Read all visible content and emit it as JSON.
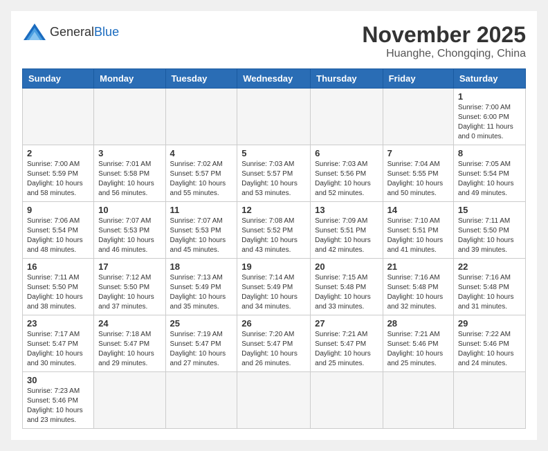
{
  "header": {
    "logo_general": "General",
    "logo_blue": "Blue",
    "title": "November 2025",
    "location": "Huanghe, Chongqing, China"
  },
  "weekdays": [
    "Sunday",
    "Monday",
    "Tuesday",
    "Wednesday",
    "Thursday",
    "Friday",
    "Saturday"
  ],
  "days": {
    "1": {
      "sunrise": "7:00 AM",
      "sunset": "6:00 PM",
      "hours": 11,
      "minutes": 0
    },
    "2": {
      "sunrise": "7:00 AM",
      "sunset": "5:59 PM",
      "hours": 10,
      "minutes": 58
    },
    "3": {
      "sunrise": "7:01 AM",
      "sunset": "5:58 PM",
      "hours": 10,
      "minutes": 56
    },
    "4": {
      "sunrise": "7:02 AM",
      "sunset": "5:57 PM",
      "hours": 10,
      "minutes": 55
    },
    "5": {
      "sunrise": "7:03 AM",
      "sunset": "5:57 PM",
      "hours": 10,
      "minutes": 53
    },
    "6": {
      "sunrise": "7:03 AM",
      "sunset": "5:56 PM",
      "hours": 10,
      "minutes": 52
    },
    "7": {
      "sunrise": "7:04 AM",
      "sunset": "5:55 PM",
      "hours": 10,
      "minutes": 50
    },
    "8": {
      "sunrise": "7:05 AM",
      "sunset": "5:54 PM",
      "hours": 10,
      "minutes": 49
    },
    "9": {
      "sunrise": "7:06 AM",
      "sunset": "5:54 PM",
      "hours": 10,
      "minutes": 48
    },
    "10": {
      "sunrise": "7:07 AM",
      "sunset": "5:53 PM",
      "hours": 10,
      "minutes": 46
    },
    "11": {
      "sunrise": "7:07 AM",
      "sunset": "5:53 PM",
      "hours": 10,
      "minutes": 45
    },
    "12": {
      "sunrise": "7:08 AM",
      "sunset": "5:52 PM",
      "hours": 10,
      "minutes": 43
    },
    "13": {
      "sunrise": "7:09 AM",
      "sunset": "5:51 PM",
      "hours": 10,
      "minutes": 42
    },
    "14": {
      "sunrise": "7:10 AM",
      "sunset": "5:51 PM",
      "hours": 10,
      "minutes": 41
    },
    "15": {
      "sunrise": "7:11 AM",
      "sunset": "5:50 PM",
      "hours": 10,
      "minutes": 39
    },
    "16": {
      "sunrise": "7:11 AM",
      "sunset": "5:50 PM",
      "hours": 10,
      "minutes": 38
    },
    "17": {
      "sunrise": "7:12 AM",
      "sunset": "5:50 PM",
      "hours": 10,
      "minutes": 37
    },
    "18": {
      "sunrise": "7:13 AM",
      "sunset": "5:49 PM",
      "hours": 10,
      "minutes": 35
    },
    "19": {
      "sunrise": "7:14 AM",
      "sunset": "5:49 PM",
      "hours": 10,
      "minutes": 34
    },
    "20": {
      "sunrise": "7:15 AM",
      "sunset": "5:48 PM",
      "hours": 10,
      "minutes": 33
    },
    "21": {
      "sunrise": "7:16 AM",
      "sunset": "5:48 PM",
      "hours": 10,
      "minutes": 32
    },
    "22": {
      "sunrise": "7:16 AM",
      "sunset": "5:48 PM",
      "hours": 10,
      "minutes": 31
    },
    "23": {
      "sunrise": "7:17 AM",
      "sunset": "5:47 PM",
      "hours": 10,
      "minutes": 30
    },
    "24": {
      "sunrise": "7:18 AM",
      "sunset": "5:47 PM",
      "hours": 10,
      "minutes": 29
    },
    "25": {
      "sunrise": "7:19 AM",
      "sunset": "5:47 PM",
      "hours": 10,
      "minutes": 27
    },
    "26": {
      "sunrise": "7:20 AM",
      "sunset": "5:47 PM",
      "hours": 10,
      "minutes": 26
    },
    "27": {
      "sunrise": "7:21 AM",
      "sunset": "5:47 PM",
      "hours": 10,
      "minutes": 25
    },
    "28": {
      "sunrise": "7:21 AM",
      "sunset": "5:46 PM",
      "hours": 10,
      "minutes": 25
    },
    "29": {
      "sunrise": "7:22 AM",
      "sunset": "5:46 PM",
      "hours": 10,
      "minutes": 24
    },
    "30": {
      "sunrise": "7:23 AM",
      "sunset": "5:46 PM",
      "hours": 10,
      "minutes": 23
    }
  }
}
